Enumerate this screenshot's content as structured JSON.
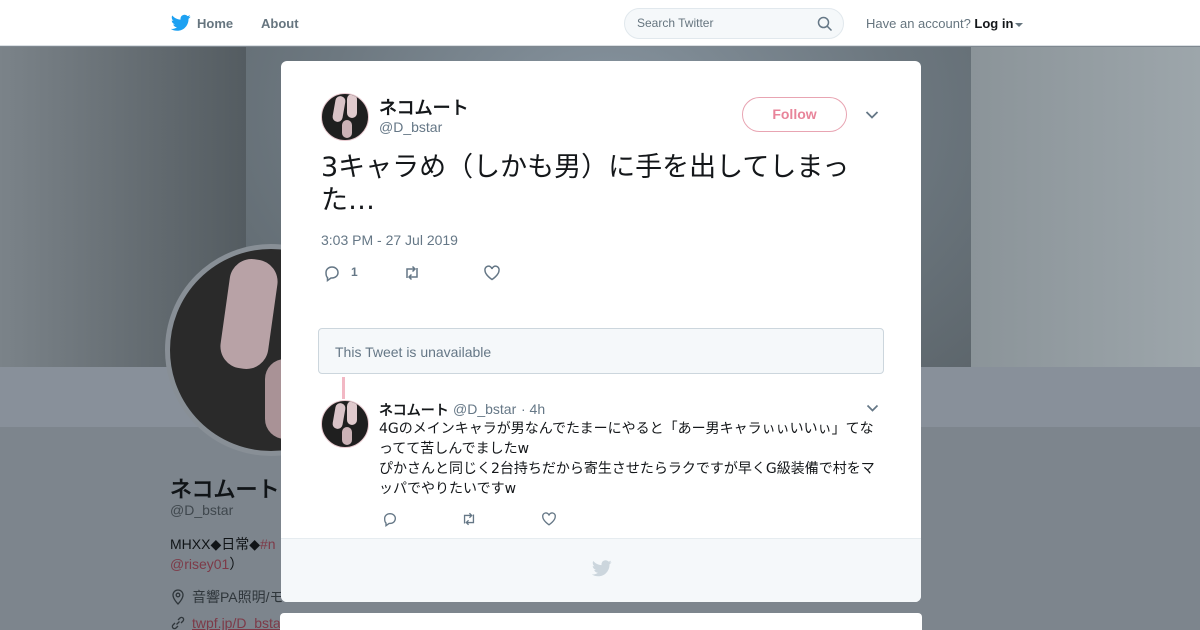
{
  "topbar": {
    "home_label": "Home",
    "about_label": "About",
    "search_placeholder": "Search Twitter",
    "account_prompt": "Have an account?",
    "login_label": "Log in"
  },
  "profile": {
    "name": "ネコムート",
    "handle": "@D_bstar",
    "bio_prefix": "MHXX◆日常◆",
    "bio_tag": "#n",
    "mention": "@risey01",
    "mention_suffix": "）",
    "location": "音響PA照明/モ",
    "url": "twpf.jp/D_bsta"
  },
  "tweet": {
    "author_name": "ネコムート",
    "author_handle": "@D_bstar",
    "follow_label": "Follow",
    "text": "3キャラめ（しかも男）に手を出してしまった…",
    "timestamp": "3:03 PM - 27 Jul 2019",
    "reply_count": "1"
  },
  "unavailable_notice": "This Tweet is unavailable",
  "reply": {
    "author_name": "ネコムート",
    "author_handle": "@D_bstar",
    "time": "· 4h",
    "line1": "4Gのメインキャラが男なんでたまーにやると「あー男キャラぃぃいいぃ」てなってて苦しんでましたw",
    "line2": "ぴかさんと同じく2台持ちだから寄生させたらラクですが早くG級装備で村をマッパでやりたいですw"
  },
  "colors": {
    "accent": "#e8849a",
    "twitter_blue": "#1da1f2",
    "muted": "#657786"
  },
  "icons": [
    "twitter-bird-icon",
    "search-icon",
    "close-icon",
    "chevron-down-icon",
    "reply-icon",
    "retweet-icon",
    "like-icon",
    "location-icon",
    "link-icon"
  ]
}
